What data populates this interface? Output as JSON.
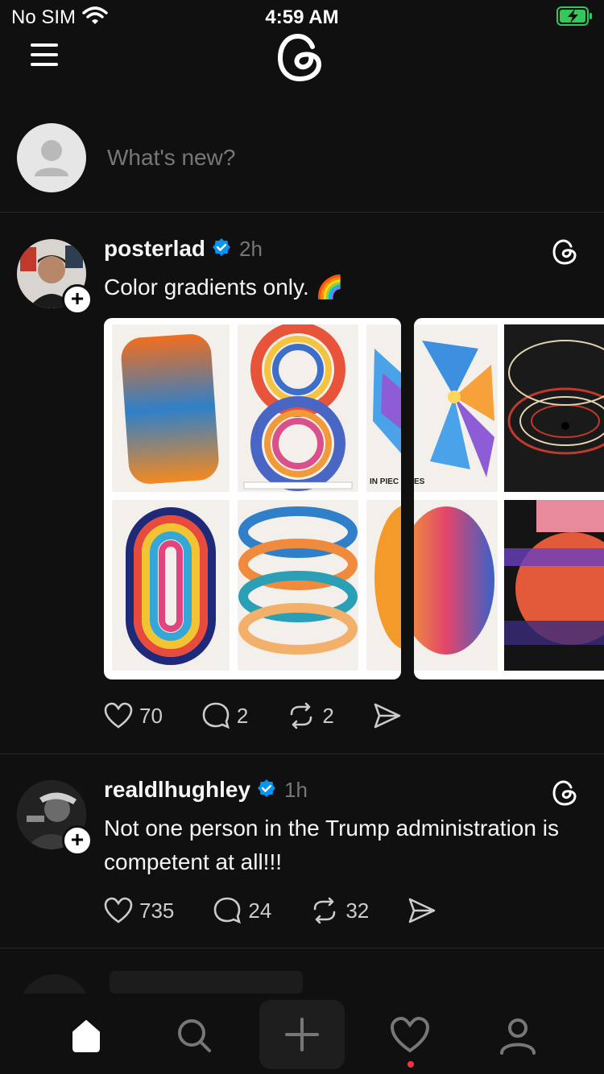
{
  "status_bar": {
    "carrier": "No SIM",
    "time": "4:59 AM"
  },
  "composer": {
    "placeholder": "What's new?"
  },
  "posts": [
    {
      "username": "posterlad",
      "time": "2h",
      "text": "Color gradients only. 🌈",
      "poster_captions": [
        "IN PIEC",
        "ES"
      ],
      "likes": "70",
      "replies": "2",
      "reposts": "2"
    },
    {
      "username": "realdlhughley",
      "time": "1h",
      "text": "Not one person in the Trump administration is competent at all!!!",
      "likes": "735",
      "replies": "24",
      "reposts": "32"
    }
  ],
  "icons": {
    "menu": "menu-icon",
    "logo": "threads-logo",
    "home": "home-icon",
    "search": "search-icon",
    "compose": "plus-icon",
    "activity": "heart-icon",
    "profile": "profile-icon"
  },
  "colors": {
    "background": "#101010",
    "verified": "#0095f6",
    "notification": "#ff3040",
    "battery": "#34c759"
  }
}
